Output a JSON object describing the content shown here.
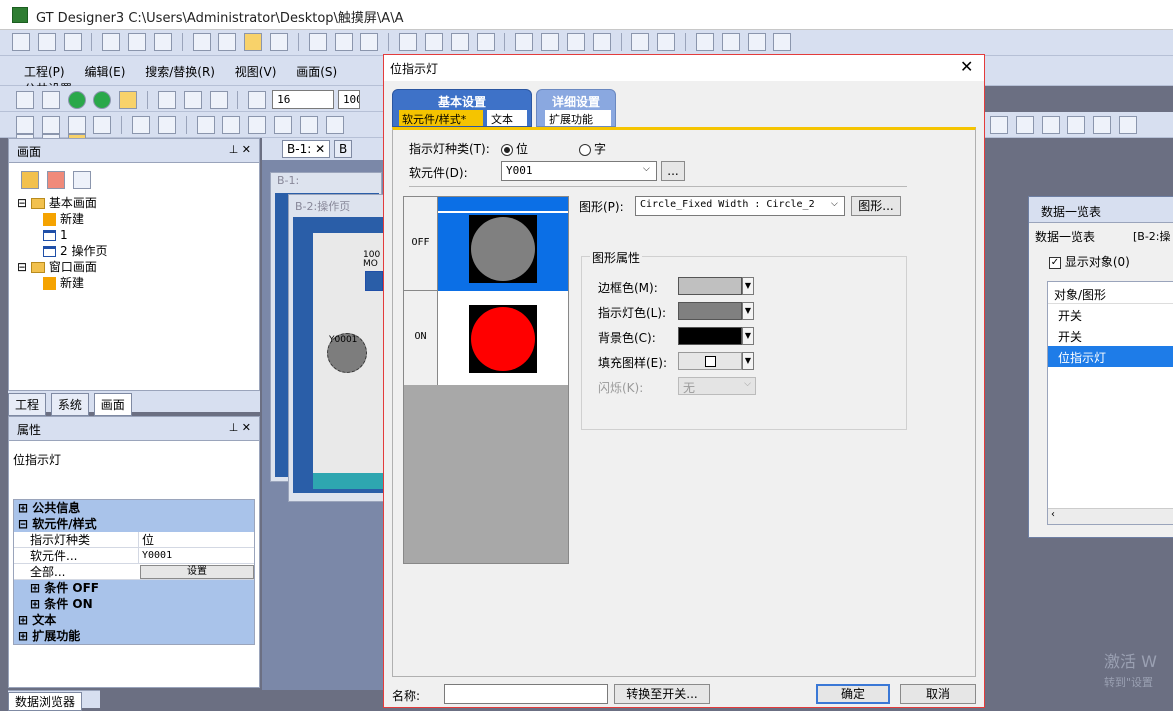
{
  "app": {
    "title": "GT Designer3 C:\\Users\\Administrator\\Desktop\\触摸屏\\A\\A"
  },
  "menu": [
    "工程(P)",
    "编辑(E)",
    "搜索/替换(R)",
    "视图(V)",
    "画面(S)",
    "公共设置"
  ],
  "toolbar": {
    "font_size": "16",
    "zoom": "100"
  },
  "screen_panel": {
    "title": "画面",
    "tree": {
      "base_folder": "基本画面",
      "base_new": "新建",
      "base_item1": "1",
      "base_item2": "2 操作页",
      "window_folder": "窗口画面",
      "window_new": "新建"
    },
    "tabs": [
      "工程",
      "系统",
      "画面"
    ]
  },
  "props_panel": {
    "title": "属性",
    "object": "位指示灯",
    "cat_common": "公共信息",
    "cat_device": "软元件/样式",
    "row_type_label": "指示灯种类",
    "row_type_value": "位",
    "row_device_label": "软元件...",
    "row_device_value": "Y0001",
    "row_all_label": "全部...",
    "row_all_button": "设置",
    "cond_off": "条件 OFF",
    "cond_on": "条件 ON",
    "cat_text": "文本",
    "cat_ext": "扩展功能",
    "bottom_tab": "数据浏览器"
  },
  "editor_tabs": [
    "B-1:",
    "B"
  ],
  "canvas": {
    "win1_title": "B-1:",
    "win2_title": "B-2:操作页",
    "lamp_label": "Y0001",
    "small_label": "100 MO"
  },
  "dialog": {
    "title": "位指示灯",
    "tab_basic": "基本设置",
    "tab_basic_sub_device": "软元件/样式*",
    "tab_basic_sub_text": "文本",
    "tab_detail": "详细设置",
    "tab_detail_sub_ext": "扩展功能",
    "lamp_type_label": "指示灯种类(T):",
    "lamp_type_bit": "位",
    "lamp_type_word": "字",
    "device_label": "软元件(D):",
    "device_value": "Y001",
    "browse_button": "...",
    "state_off": "OFF",
    "state_on": "ON",
    "shape_label": "图形(P):",
    "shape_value": "Circle_Fixed Width : Circle_2",
    "shape_button": "图形...",
    "shape_props_title": "图形属性",
    "frame_color_label": "边框色(M):",
    "lamp_color_label": "指示灯色(L):",
    "bg_color_label": "背景色(C):",
    "fill_pattern_label": "填充图样(E):",
    "blink_label": "闪烁(K):",
    "blink_value": "无",
    "name_label": "名称:",
    "name_value": "",
    "convert_button": "转换至开关...",
    "ok_button": "确定",
    "cancel_button": "取消"
  },
  "colors": {
    "frame_color": "#c0c0c0",
    "lamp_color": "#808080",
    "bg_color": "#000000",
    "off_lamp": "#808080",
    "on_lamp": "#ff0000",
    "preview_bg": "#0b6fe6",
    "accent": "#f5c400"
  },
  "data_list": {
    "title": "数据一览表",
    "subtitle": "数据一览表",
    "subtitle_right": "[B-2:操",
    "show_objects": "显示对象(0)",
    "column": "对象/图形",
    "items": [
      "开关",
      "开关",
      "位指示灯"
    ]
  },
  "watermark": {
    "line1": "激活 W",
    "line2": "转到\"设置"
  }
}
